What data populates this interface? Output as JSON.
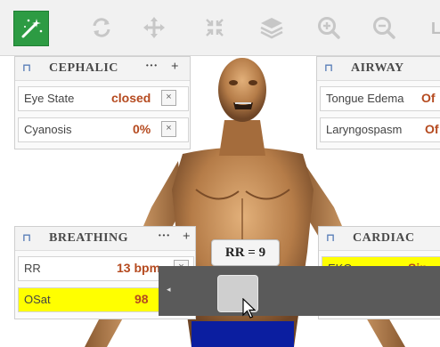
{
  "toolbar": {
    "tools": [
      {
        "name": "magic-wand",
        "active": true
      },
      {
        "name": "rotate"
      },
      {
        "name": "move"
      },
      {
        "name": "collapse"
      },
      {
        "name": "layers"
      },
      {
        "name": "zoom-in"
      },
      {
        "name": "zoom-out"
      }
    ],
    "trailing_glyph": "L"
  },
  "panels": {
    "cephalic": {
      "title": "CEPHALIC",
      "dots": "···",
      "plus": "+",
      "rows": [
        {
          "label": "Eye State",
          "value": "closed"
        },
        {
          "label": "Cyanosis",
          "value": "0%"
        }
      ]
    },
    "airway": {
      "title": "AIRWAY",
      "rows": [
        {
          "label": "Tongue Edema",
          "value": "Of"
        },
        {
          "label": "Laryngospasm",
          "value": "Of"
        }
      ]
    },
    "breathing": {
      "title": "BREATHING",
      "dots": "···",
      "plus": "+",
      "rows": [
        {
          "label": "RR",
          "value": "13 bpm"
        },
        {
          "label": "OSat",
          "value": "98"
        }
      ]
    },
    "cardiac": {
      "title": "CARDIAC",
      "rows": [
        {
          "label": "EKG",
          "value": "Sin"
        }
      ]
    }
  },
  "tooltip": {
    "text": "RR = 9"
  },
  "slider": {
    "value": 9,
    "left_arrow": "◂"
  },
  "pin_glyph": "⊓",
  "close_glyph": "×",
  "colors": {
    "accent": "#2d9b43",
    "value": "#b54a1f",
    "highlight": "#ffff00",
    "slider": "#5a5a5a"
  }
}
